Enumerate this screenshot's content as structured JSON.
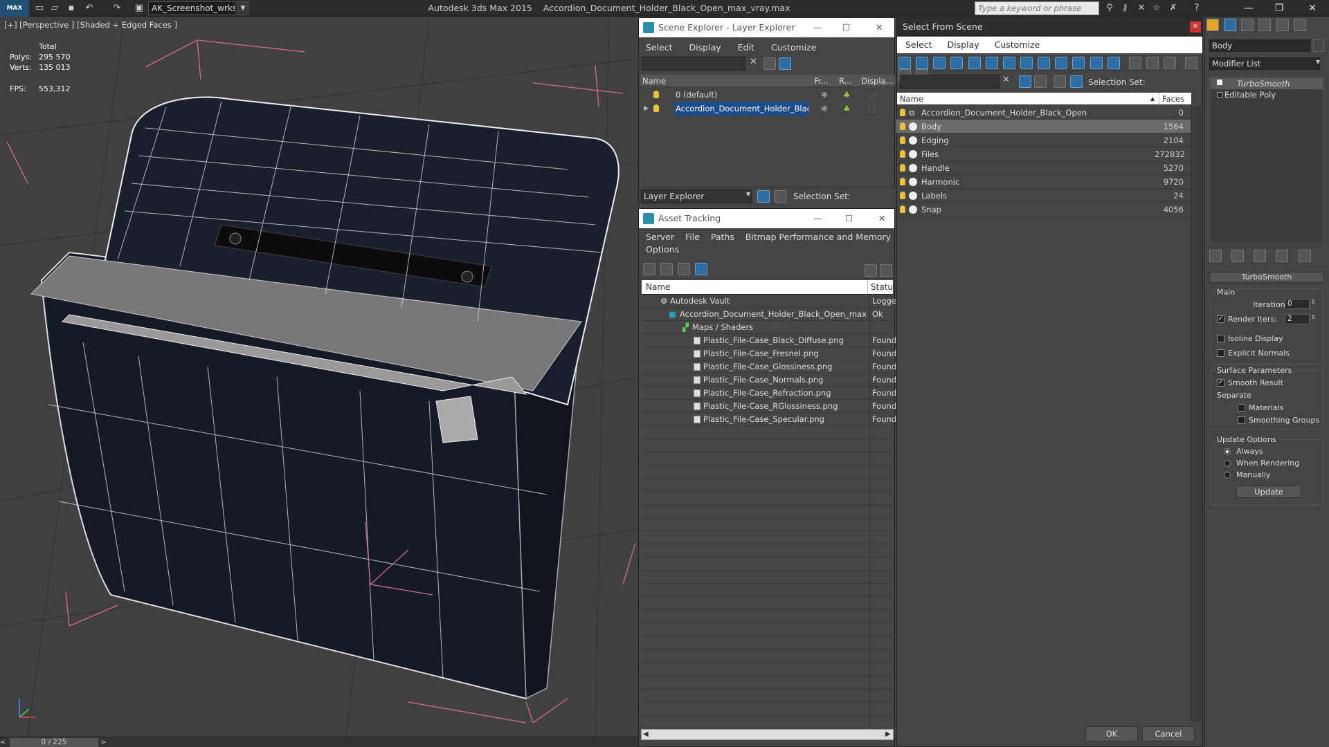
{
  "app": {
    "name": "Autodesk 3ds Max  2015",
    "file": "Accordion_Document_Holder_Black_Open_max_vray.max",
    "workspace": "AK_Screenshot_wrksp",
    "search_placeholder": "Type a keyword or phrase",
    "logo": "MAX"
  },
  "viewport": {
    "label": "[+] [Perspective ] [Shaded + Edged Faces ]",
    "stats": {
      "total_label": "Total",
      "polys_label": "Polys:",
      "polys_value": "295 570",
      "verts_label": "Verts:",
      "verts_value": "135 013",
      "fps_label": "FPS:",
      "fps_value": "553,312"
    },
    "time_slider": "0 / 225",
    "time_prev": "<",
    "time_next": ">"
  },
  "scene_explorer": {
    "title": "Scene Explorer - Layer Explorer",
    "menu": [
      "Select",
      "Display",
      "Edit",
      "Customize"
    ],
    "columns": [
      "Name",
      "Fr...",
      "R...",
      "Displa..."
    ],
    "rows": [
      {
        "name": "0 (default)",
        "selected": false
      },
      {
        "name": "Accordion_Document_Holder_Black_...",
        "selected": true
      }
    ],
    "footer_label": "Layer Explorer",
    "selection_set_label": "Selection Set:"
  },
  "asset_tracking": {
    "title": "Asset Tracking",
    "menu": [
      "Server",
      "File",
      "Paths",
      "Bitmap Performance and Memory"
    ],
    "menu2": [
      "Options"
    ],
    "columns": [
      "Name",
      "Status"
    ],
    "rows": [
      {
        "name": "Autodesk Vault",
        "status": "Logged",
        "indent": 1
      },
      {
        "name": "Accordion_Document_Holder_Black_Open_max...",
        "status": "Ok",
        "indent": 2
      },
      {
        "name": "Maps / Shaders",
        "status": "",
        "indent": 3
      },
      {
        "name": "Plastic_File-Case_Black_Diffuse.png",
        "status": "Found",
        "indent": 4
      },
      {
        "name": "Plastic_File-Case_Fresnel.png",
        "status": "Found",
        "indent": 4
      },
      {
        "name": "Plastic_File-Case_Glossiness.png",
        "status": "Found",
        "indent": 4
      },
      {
        "name": "Plastic_File-Case_Normals.png",
        "status": "Found",
        "indent": 4
      },
      {
        "name": "Plastic_File-Case_Refraction.png",
        "status": "Found",
        "indent": 4
      },
      {
        "name": "Plastic_File-Case_RGlossiness.png",
        "status": "Found",
        "indent": 4
      },
      {
        "name": "Plastic_File-Case_Specular.png",
        "status": "Found",
        "indent": 4
      }
    ]
  },
  "select_from_scene": {
    "title": "Select From Scene",
    "menu": [
      "Select",
      "Display",
      "Customize"
    ],
    "selection_set_label": "Selection Set:",
    "columns": [
      "Name",
      "Faces"
    ],
    "rows": [
      {
        "name": "Accordion_Document_Holder_Black_Open",
        "faces": "0"
      },
      {
        "name": "Body",
        "faces": "1564"
      },
      {
        "name": "Edging",
        "faces": "2104"
      },
      {
        "name": "Files",
        "faces": "272832"
      },
      {
        "name": "Handle",
        "faces": "5270"
      },
      {
        "name": "Harmonic",
        "faces": "9720"
      },
      {
        "name": "Labels",
        "faces": "24"
      },
      {
        "name": "Snap",
        "faces": "4056"
      }
    ],
    "ok": "OK",
    "cancel": "Cancel"
  },
  "command_panel": {
    "object_name": "Body",
    "modifier_list": "Modifier List",
    "stack": [
      "TurboSmooth",
      "Editable Poly"
    ],
    "rollout_title": "TurboSmooth",
    "main_label": "Main",
    "iterations_label": "Iterations:",
    "iterations_value": "0",
    "render_iters_label": "Render Iters:",
    "render_iters_value": "2",
    "isoline_label": "Isoline Display",
    "explicit_label": "Explicit Normals",
    "surface_label": "Surface Parameters",
    "smooth_label": "Smooth Result",
    "separate_label": "Separate",
    "materials_label": "Materials",
    "smoothing_label": "Smoothing Groups",
    "update_options_label": "Update Options",
    "always_label": "Always",
    "when_rendering_label": "When Rendering",
    "manually_label": "Manually",
    "update_button": "Update"
  }
}
